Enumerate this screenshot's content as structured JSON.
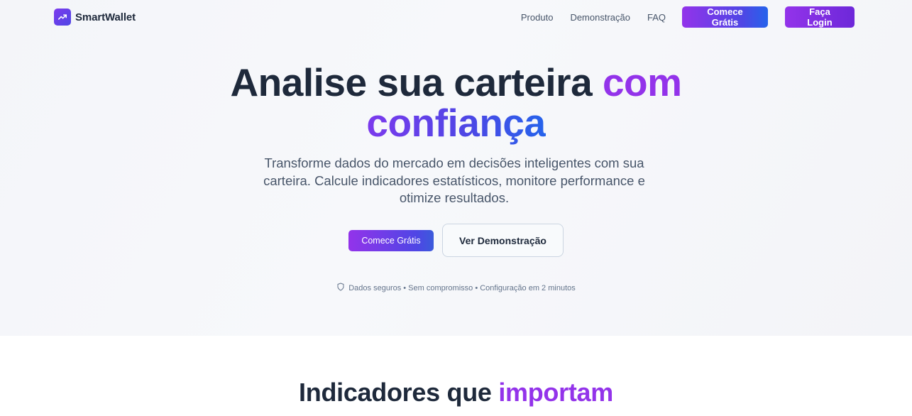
{
  "brand": {
    "name": "SmartWallet",
    "logo_icon": "trending-up-icon"
  },
  "nav": {
    "links": [
      "Produto",
      "Demonstração",
      "FAQ"
    ],
    "start_label": "Comece Grátis",
    "login_label": "Faça Login"
  },
  "hero": {
    "title_part1": "Analise sua carteira ",
    "title_accent1": "com",
    "title_accent2": "confiança",
    "subtitle": "Transforme dados do mercado em decisões inteligentes com sua carteira. Calcule indicadores estatísticos, monitore performance e otimize resultados.",
    "cta_primary": "Comece Grátis",
    "cta_secondary": "Ver Demonstração",
    "trust_icon": "shield-icon",
    "trust_text": "Dados seguros • Sem compromisso • Configuração em 2 minutos"
  },
  "features": {
    "title_part1": "Indicadores que ",
    "title_accent": "importam"
  },
  "colors": {
    "accent_purple": "#9333ea",
    "accent_indigo": "#4f46e5",
    "accent_blue": "#2563eb",
    "text_dark": "#1e293b",
    "text_muted": "#475569"
  }
}
